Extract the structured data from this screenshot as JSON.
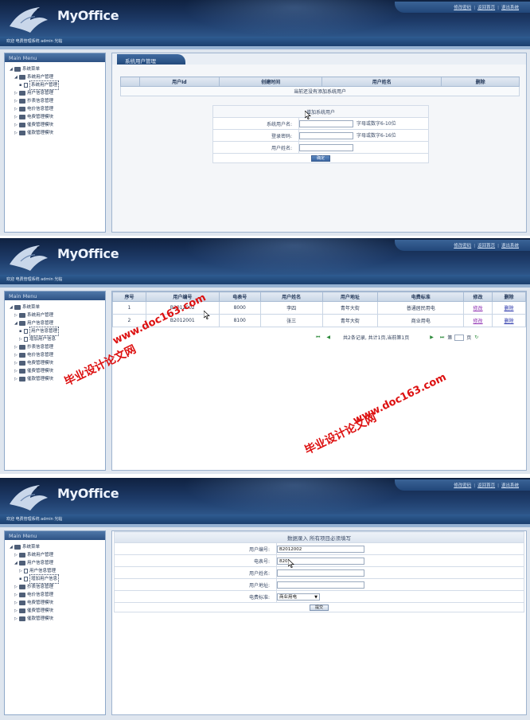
{
  "header": {
    "logo": "MyOffice",
    "links": [
      "修改密码",
      "返回首页",
      "退出系统"
    ],
    "welcome": "欢迎 电费管理系统 admin 光临"
  },
  "sidebar": {
    "title": "Main Menu",
    "root": "系统菜单",
    "sys_user_mgmt": "系统用户管理",
    "sys_user_mgmt_child": "系统用户管理",
    "user_info_mgmt": "用户信息管理",
    "user_info_mgmt_child": "用户信息管理",
    "add_user_info": "增加用户信息",
    "meter_mgmt": "抄表信息管理",
    "price_mgmt": "电价信息管理",
    "fee_mgmt": "电费管理模块",
    "pay_mgmt": "催费管理模块",
    "owed_mgmt": "催款管理模块"
  },
  "panel1": {
    "tab": "系统用户管理",
    "columns": [
      "用户Id",
      "创建时间",
      "用户姓名",
      "删除"
    ],
    "empty_text": "当前还没有添加系统用户",
    "form": {
      "title": "增加系统用户",
      "fields": [
        {
          "label": "系统用户名:",
          "hint": "字母或数字6-10位"
        },
        {
          "label": "登录密码:",
          "hint": "字母或数字6-16位"
        },
        {
          "label": "用户姓名:",
          "hint": ""
        }
      ],
      "submit": "确定"
    }
  },
  "panel2": {
    "columns": [
      "序号",
      "用户编号",
      "电表号",
      "用户姓名",
      "用户地址",
      "电费标准",
      "修改",
      "删除"
    ],
    "rows": [
      {
        "no": "1",
        "user_id": "B2012002",
        "meter": "8000",
        "name": "李四",
        "address": "青年大街",
        "standard": "普通居民用电",
        "edit": "修改",
        "delete": "删除"
      },
      {
        "no": "2",
        "user_id": "B2012001",
        "meter": "8100",
        "name": "张三",
        "address": "青年大街",
        "standard": "商业用电",
        "edit": "修改",
        "delete": "删除"
      }
    ],
    "pager": {
      "summary": "共2条记录, 共计1页,当前第1页",
      "goto_label": "第",
      "page_unit": "页"
    }
  },
  "panel3": {
    "title": "数据录入 所有项目必须填写",
    "fields": [
      {
        "label": "用户编号:",
        "value": "B2012002"
      },
      {
        "label": "电表号:",
        "value": "820"
      },
      {
        "label": "用户姓名:",
        "value": ""
      },
      {
        "label": "用户地址:",
        "value": ""
      }
    ],
    "standard_label": "电费标准:",
    "standard_value": "商业用电",
    "submit": "提交"
  },
  "watermark": {
    "site": "www.doc163.com",
    "name": "毕业设计论文网"
  }
}
